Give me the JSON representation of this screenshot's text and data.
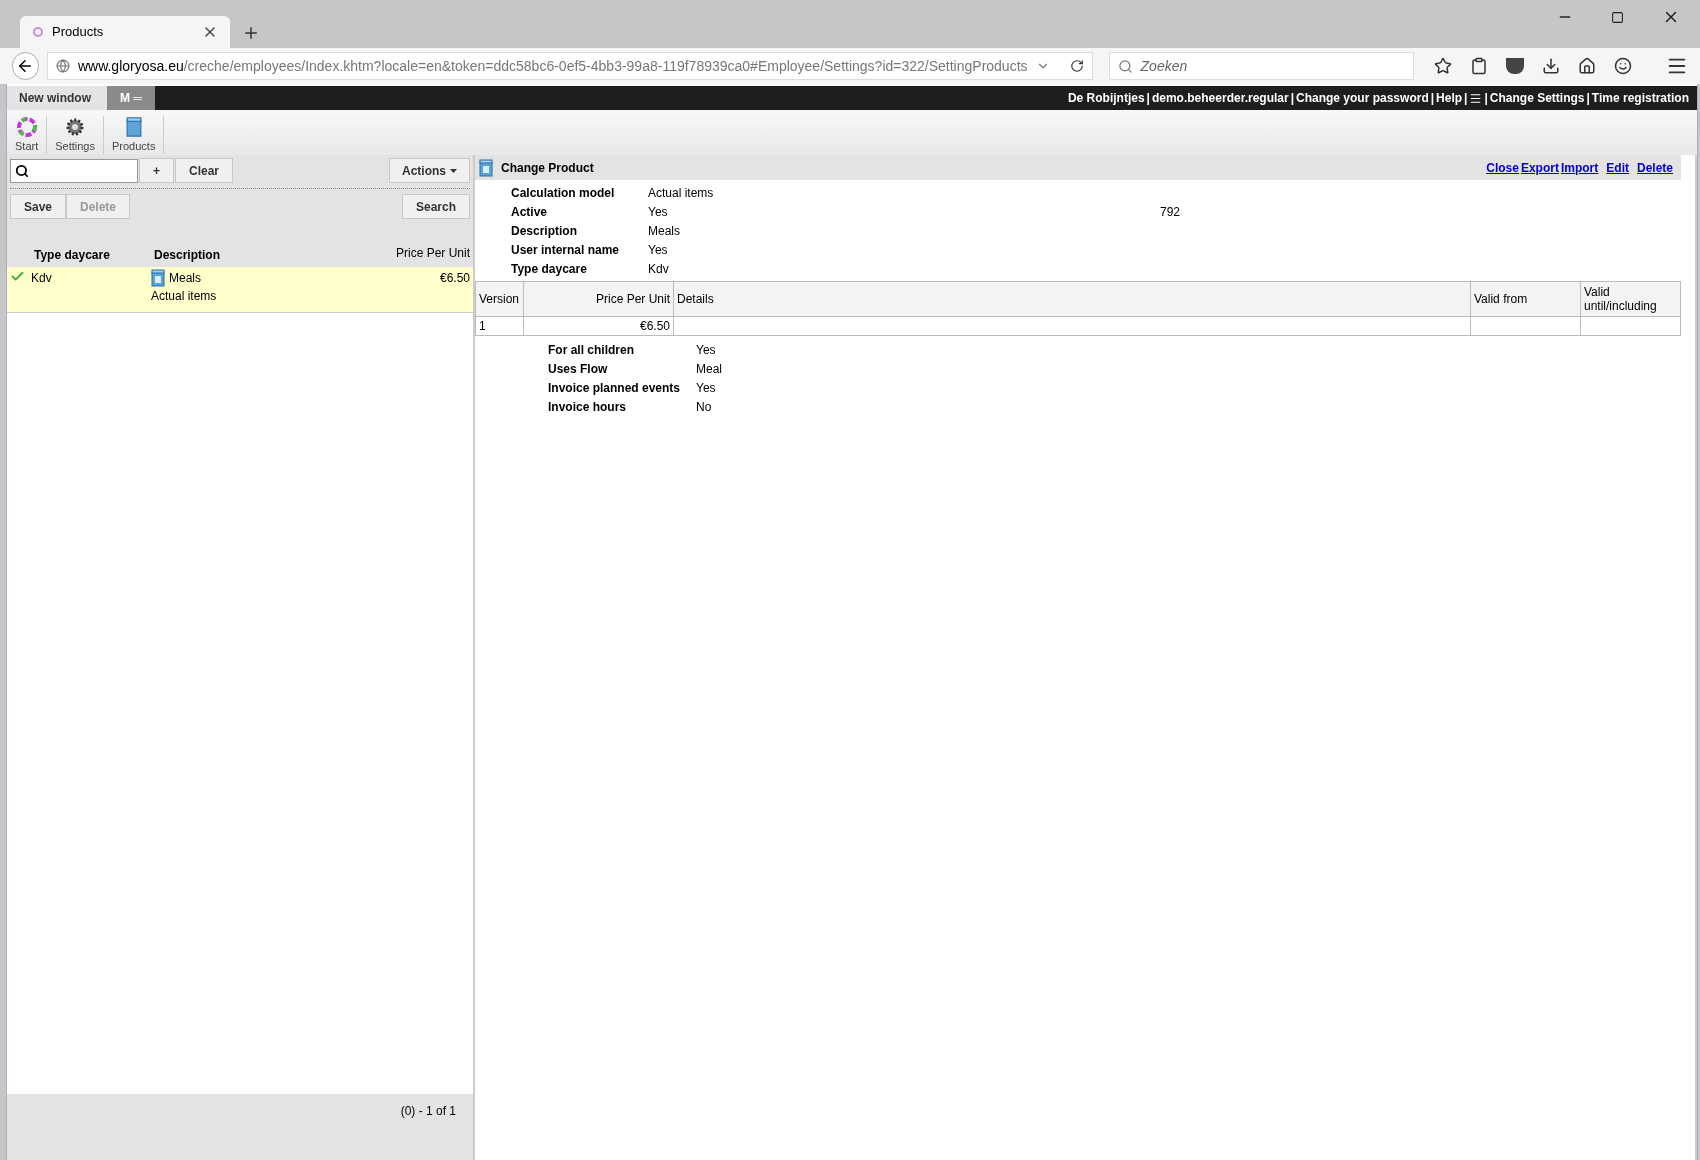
{
  "browser": {
    "tab_title": "Products",
    "url_host": "www.gloryosa.eu",
    "url_path": "/creche/employees/Index.khtm?locale=en&token=ddc58bc6-0ef5-4bb3-99a8-119f78939ca0#Employee/Settings?id=322/SettingProducts",
    "search_placeholder": "Zoeken"
  },
  "app_tabs": [
    {
      "label": "New window",
      "selected": true
    },
    {
      "label": "M ═",
      "selected": false
    }
  ],
  "header": {
    "separator": "|",
    "items": [
      {
        "kind": "link",
        "label": "De Robijntjes"
      },
      {
        "kind": "link",
        "label": "demo.beheerder.regular"
      },
      {
        "kind": "link",
        "label": "Change your password"
      },
      {
        "kind": "link",
        "label": "Help"
      },
      {
        "kind": "menu"
      },
      {
        "kind": "link",
        "label": "Change Settings"
      },
      {
        "kind": "link",
        "label": "Time registration"
      }
    ]
  },
  "breadcrumb": [
    {
      "kind": "start",
      "label": "Start"
    },
    {
      "kind": "settings",
      "label": "Settings"
    },
    {
      "kind": "product",
      "label": "Products"
    }
  ],
  "left": {
    "buttons_top": [
      {
        "label": "+",
        "disabled": false
      },
      {
        "label": "Clear",
        "disabled": false
      }
    ],
    "actions": "Actions",
    "buttons": [
      {
        "label": "Save",
        "disabled": false
      },
      {
        "label": "Delete",
        "disabled": true
      }
    ],
    "search": "Search",
    "columns": [
      "Type daycare",
      "Description",
      "Price Per Unit"
    ],
    "rows": [
      {
        "type": "Kdv",
        "description": "Meals",
        "sub": "Actual items",
        "price": "€6.50",
        "selected": true,
        "checked": true
      }
    ],
    "footer": "(0) - 1 of 1"
  },
  "detail": {
    "title": "Change Product",
    "actions": [
      "Close",
      "Export",
      "Import",
      "Edit",
      "Delete"
    ],
    "fields": [
      {
        "label": "Calculation model",
        "value": "Actual items"
      },
      {
        "label": "Active",
        "value": "Yes",
        "aside": "792"
      },
      {
        "label": "Description",
        "value": "Meals"
      },
      {
        "label": "User internal name",
        "value": "Yes"
      },
      {
        "label": "Type daycare",
        "value": "Kdv"
      }
    ],
    "table": {
      "columns": [
        "Version",
        "Price Per Unit",
        "Details",
        "Valid from",
        "Valid until/including"
      ],
      "rows": [
        [
          "1",
          "€6.50",
          "",
          "",
          ""
        ]
      ]
    },
    "extra_fields": [
      {
        "label": "For all children",
        "value": "Yes"
      },
      {
        "label": "Uses Flow",
        "value": "Meal"
      },
      {
        "label": "Invoice planned events",
        "value": "Yes"
      },
      {
        "label": "Invoice hours",
        "value": "No"
      }
    ]
  }
}
